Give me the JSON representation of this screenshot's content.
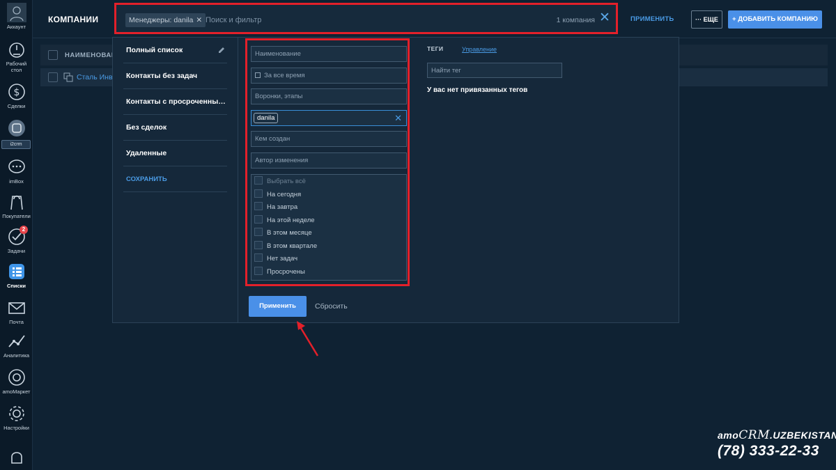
{
  "sidebar": {
    "items": [
      {
        "label": "Аккаунт",
        "icon": "account-icon"
      },
      {
        "label": "Рабочий стол",
        "icon": "dashboard-icon"
      },
      {
        "label": "Сделки",
        "icon": "deals-icon"
      },
      {
        "label": "i2crm",
        "icon": "i2crm-icon"
      },
      {
        "label": "imBox",
        "icon": "chat-icon"
      },
      {
        "label": "Покупатели",
        "icon": "customers-icon"
      },
      {
        "label": "Задачи",
        "icon": "tasks-icon",
        "badge": "2"
      },
      {
        "label": "Списки",
        "icon": "lists-icon",
        "active": true
      },
      {
        "label": "Почта",
        "icon": "mail-icon"
      },
      {
        "label": "Аналитика",
        "icon": "analytics-icon"
      },
      {
        "label": "amoМаркет",
        "icon": "market-icon"
      },
      {
        "label": "Настройки",
        "icon": "settings-icon"
      }
    ]
  },
  "header": {
    "title": "КОМПАНИИ",
    "filter_chip": "Менеджеры: danila",
    "filter_placeholder": "Поиск и фильтр",
    "count": "1 компания",
    "apply_label": "ПРИМЕНИТЬ",
    "more_label": "ЕЩЕ",
    "add_label": "ДОБАВИТЬ КОМПАНИЮ"
  },
  "table": {
    "column": "НАИМЕНОВАН",
    "rows": [
      {
        "name": "Сталь Инве"
      }
    ]
  },
  "presets": {
    "items": [
      "Полный список",
      "Контакты без задач",
      "Контакты с просроченным...",
      "Без сделок",
      "Удаленные"
    ],
    "save_label": "СОХРАНИТЬ"
  },
  "filters": {
    "name_placeholder": "Наименование",
    "period": "За все время",
    "pipelines": "Воронки, этапы",
    "manager_tag": "danila",
    "created_by": "Кем создан",
    "modified_by": "Автор изменения",
    "tasks": [
      "Выбрать всё",
      "На сегодня",
      "На завтра",
      "На этой неделе",
      "В этом месяце",
      "В этом квартале",
      "Нет задач",
      "Просрочены"
    ],
    "apply_label": "Применить",
    "reset_label": "Сбросить"
  },
  "tags": {
    "title": "ТЕГИ",
    "manage_label": "Управление",
    "search_placeholder": "Найти тег",
    "empty_text": "У вас нет привязанных тегов"
  },
  "branding": {
    "name_prefix": "amo",
    "name_crm": "CRM",
    "name_suffix": ".UZBEKISTAN",
    "phone": "(78) 333-22-33"
  },
  "colors": {
    "accent": "#4a90e8",
    "highlight": "#e3202a",
    "background": "#0f2233"
  }
}
